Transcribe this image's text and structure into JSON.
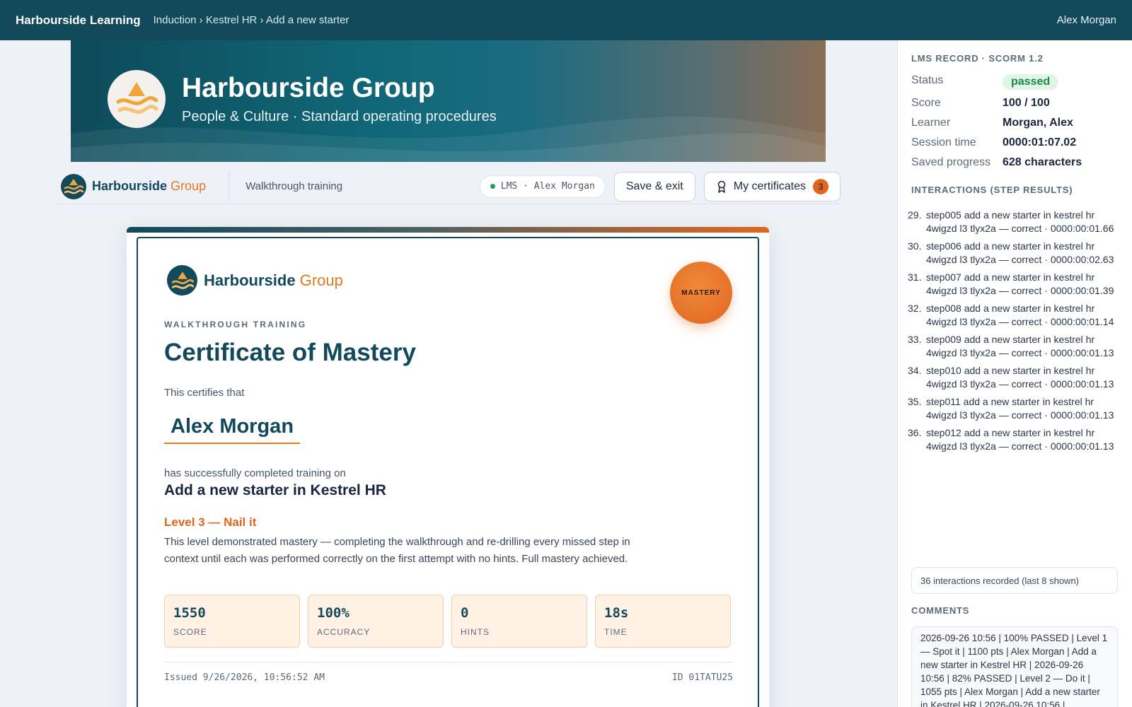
{
  "topbar": {
    "brand": "Harbourside Learning",
    "breadcrumb": "Induction › Kestrel HR › Add a new starter",
    "user": "Alex Morgan"
  },
  "hero": {
    "title": "Harbourside Group",
    "subtitle": "People & Culture · Standard operating procedures"
  },
  "toolbar": {
    "brand_main": "Harbourside",
    "brand_accent": "Group",
    "module": "Walkthrough training",
    "lms_status": "LMS · Alex Morgan",
    "save_exit": "Save & exit",
    "certificates": "My certificates",
    "certificates_count": "3"
  },
  "certificate": {
    "brand_main": "Harbourside",
    "brand_accent": "Group",
    "seal": "MASTERY",
    "kicker": "WALKTHROUGH TRAINING",
    "title": "Certificate of Mastery",
    "certifies": "This certifies that",
    "learner": "Alex Morgan",
    "completed_on": "has successfully completed training on",
    "course": "Add a new starter in Kestrel HR",
    "level": "Level 3 — Nail it",
    "level_description": "This level demonstrated mastery — completing the walkthrough and re-drilling every missed step in context until each was performed correctly on the first attempt with no hints. Full mastery achieved.",
    "stats": [
      {
        "value": "1550",
        "label": "SCORE"
      },
      {
        "value": "100%",
        "label": "ACCURACY"
      },
      {
        "value": "0",
        "label": "HINTS"
      },
      {
        "value": "18s",
        "label": "TIME"
      }
    ],
    "issued": "Issued 9/26/2026, 10:56:52 AM",
    "id": "ID 01TATU25"
  },
  "lms": {
    "heading": "LMS RECORD · SCORM 1.2",
    "status_label": "Status",
    "status_value": "passed",
    "score_label": "Score",
    "score_value": "100 / 100",
    "learner_label": "Learner",
    "learner_value": "Morgan, Alex",
    "session_label": "Session time",
    "session_value": "0000:01:07.02",
    "progress_label": "Saved progress",
    "progress_value": "628 characters",
    "interactions_heading": "INTERACTIONS (STEP RESULTS)",
    "interactions": [
      {
        "num": "29.",
        "text": "step005 add a new starter in kestrel hr 4wigzd l3 tlyx2a — correct · 0000:00:01.66"
      },
      {
        "num": "30.",
        "text": "step006 add a new starter in kestrel hr 4wigzd l3 tlyx2a — correct · 0000:00:02.63"
      },
      {
        "num": "31.",
        "text": "step007 add a new starter in kestrel hr 4wigzd l3 tlyx2a — correct · 0000:00:01.39"
      },
      {
        "num": "32.",
        "text": "step008 add a new starter in kestrel hr 4wigzd l3 tlyx2a — correct · 0000:00:01.14"
      },
      {
        "num": "33.",
        "text": "step009 add a new starter in kestrel hr 4wigzd l3 tlyx2a — correct · 0000:00:01.13"
      },
      {
        "num": "34.",
        "text": "step010 add a new starter in kestrel hr 4wigzd l3 tlyx2a — correct · 0000:00:01.13"
      },
      {
        "num": "35.",
        "text": "step011 add a new starter in kestrel hr 4wigzd l3 tlyx2a — correct · 0000:00:01.13"
      },
      {
        "num": "36.",
        "text": "step012 add a new starter in kestrel hr 4wigzd l3 tlyx2a — correct · 0000:00:01.13"
      }
    ],
    "interactions_count": "36 interactions recorded (last 8 shown)",
    "comments_heading": "COMMENTS",
    "comments": "2026-09-26 10:56 | 100% PASSED | Level 1 — Spot it | 1100 pts | Alex Morgan | Add a new starter in Kestrel HR | 2026-09-26 10:56 | 82% PASSED | Level 2 — Do it | 1055 pts | Alex Morgan | Add a new starter in Kestrel HR | 2026-09-26 10:56 |"
  },
  "colors": {
    "primary": "#124a5c",
    "accent": "#e07a1f",
    "passed": "#1c8a44"
  }
}
